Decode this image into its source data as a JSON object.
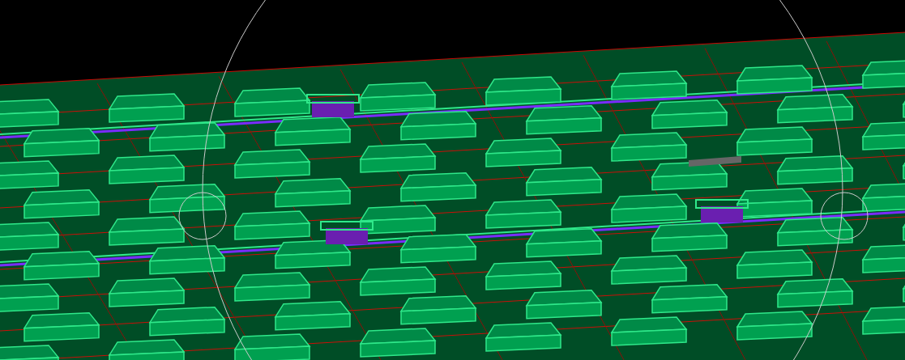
{
  "viewport": {
    "kind": "pcb-3d"
  }
}
